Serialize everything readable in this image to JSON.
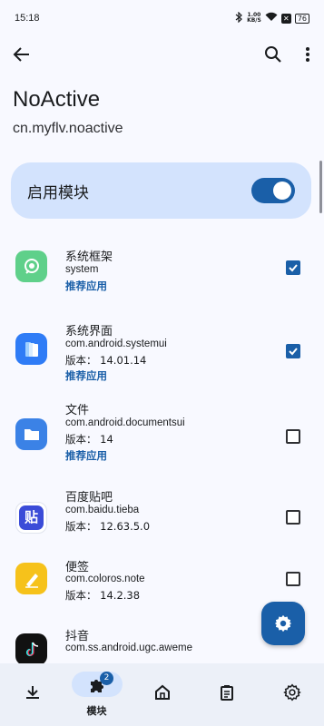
{
  "status_bar": {
    "time": "15:18",
    "speed_top": "1.00",
    "speed_unit": "KB/S",
    "battery": "76"
  },
  "page": {
    "title": "NoActive",
    "subtitle": "cn.myflv.noactive"
  },
  "enable_card": {
    "label": "启用模块",
    "enabled": true
  },
  "apps": [
    {
      "name": "系统框架",
      "package": "system",
      "version": "",
      "recommend": "推荐应用",
      "checked": true,
      "icon": "system-framework-icon",
      "color": "#5fd08a"
    },
    {
      "name": "系统界面",
      "package": "com.android.systemui",
      "version": "版本： 14.01.14",
      "recommend": "推荐应用",
      "checked": true,
      "icon": "system-ui-icon",
      "color": "#2f7cf6"
    },
    {
      "name": "文件",
      "package": "com.android.documentsui",
      "version": "版本： 14",
      "recommend": "推荐应用",
      "checked": false,
      "icon": "files-icon",
      "color": "#3b82e6"
    },
    {
      "name": "百度贴吧",
      "package": "com.baidu.tieba",
      "version": "版本： 12.63.5.0",
      "recommend": "",
      "checked": false,
      "icon": "tieba-icon",
      "color": "#3b4cd8"
    },
    {
      "name": "便签",
      "package": "com.coloros.note",
      "version": "版本： 14.2.38",
      "recommend": "",
      "checked": false,
      "icon": "notes-icon",
      "color": "#f6c21b"
    },
    {
      "name": "抖音",
      "package": "com.ss.android.ugc.aweme",
      "version": "",
      "recommend": "",
      "checked": false,
      "icon": "douyin-icon",
      "color": "#111111"
    }
  ],
  "tieba_glyph": "贴",
  "bottom_nav": {
    "items": [
      {
        "id": "download",
        "label": ""
      },
      {
        "id": "modules",
        "label": "模块",
        "badge": "2"
      },
      {
        "id": "home",
        "label": ""
      },
      {
        "id": "logs",
        "label": ""
      },
      {
        "id": "settings",
        "label": ""
      }
    ]
  },
  "colors": {
    "accent": "#1a5fa8",
    "accent_container": "#d3e3fd"
  }
}
